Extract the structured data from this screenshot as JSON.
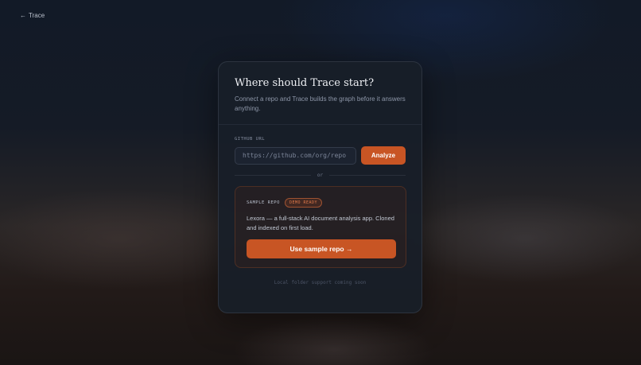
{
  "nav": {
    "back_arrow": "←",
    "back_label": "Trace"
  },
  "card": {
    "title": "Where should Trace start?",
    "subtitle": "Connect a repo and Trace builds the graph before it answers anything.",
    "github_label": "GITHUB URL",
    "url_placeholder": "https://github.com/org/repo",
    "url_value": "",
    "analyze_label": "Analyze",
    "divider_text": "or",
    "sample": {
      "label": "SAMPLE REPO",
      "badge": "DEMO READY",
      "description": "Lexora — a full-stack AI document analysis app. Cloned and indexed on first load.",
      "button_label": "Use sample repo →"
    },
    "footnote": "Local folder support coming soon"
  },
  "colors": {
    "accent": "#c85524",
    "background": "#0f1520",
    "card": "#181e28"
  }
}
